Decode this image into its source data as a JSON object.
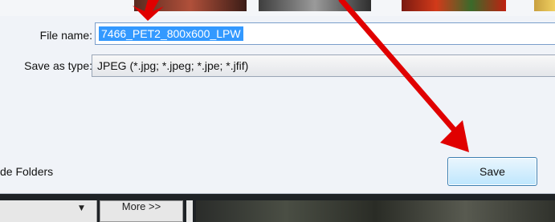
{
  "dialog": {
    "file_name_label": "File name:",
    "file_name_value": "7466_PET2_800x600_LPW",
    "save_as_type_label": "Save as type:",
    "save_as_type_value": "JPEG (*.jpg; *.jpeg; *.jpe; *.jfif)",
    "hide_folders_label": "de Folders",
    "save_label": "Save"
  },
  "bottom_bar": {
    "more_label": "More >>"
  },
  "colors": {
    "selection": "#3399ff",
    "annotation_arrow": "#e00000"
  }
}
